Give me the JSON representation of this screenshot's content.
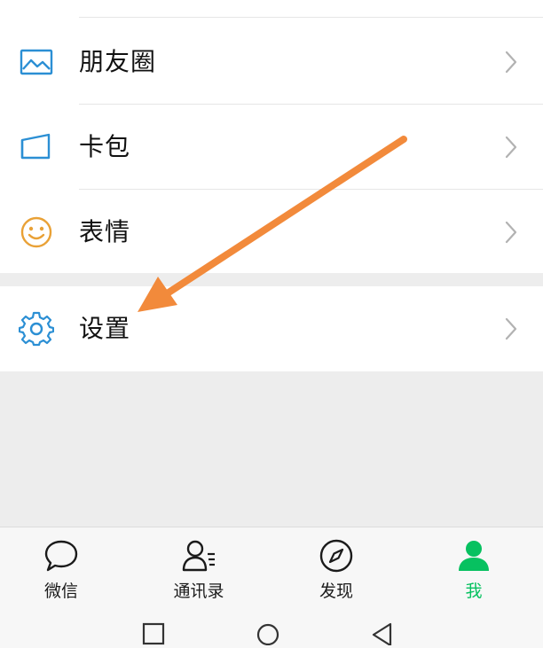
{
  "menu": {
    "moments": {
      "label": "朋友圈",
      "icon": "moments-image-icon"
    },
    "cards": {
      "label": "卡包",
      "icon": "card-wallet-icon"
    },
    "stickers": {
      "label": "表情",
      "icon": "smiley-face-icon"
    },
    "settings": {
      "label": "设置",
      "icon": "gear-icon"
    }
  },
  "tabbar": {
    "chats": {
      "label": "微信",
      "icon": "chat-bubble-icon"
    },
    "contacts": {
      "label": "通讯录",
      "icon": "contacts-icon"
    },
    "discover": {
      "label": "发现",
      "icon": "compass-icon"
    },
    "me": {
      "label": "我",
      "icon": "person-icon",
      "active": true
    }
  },
  "colors": {
    "accent": "#07c160",
    "icon_blue": "#2b8fd4",
    "icon_orange": "#e9a136",
    "annotation_arrow": "#f28a3b"
  }
}
